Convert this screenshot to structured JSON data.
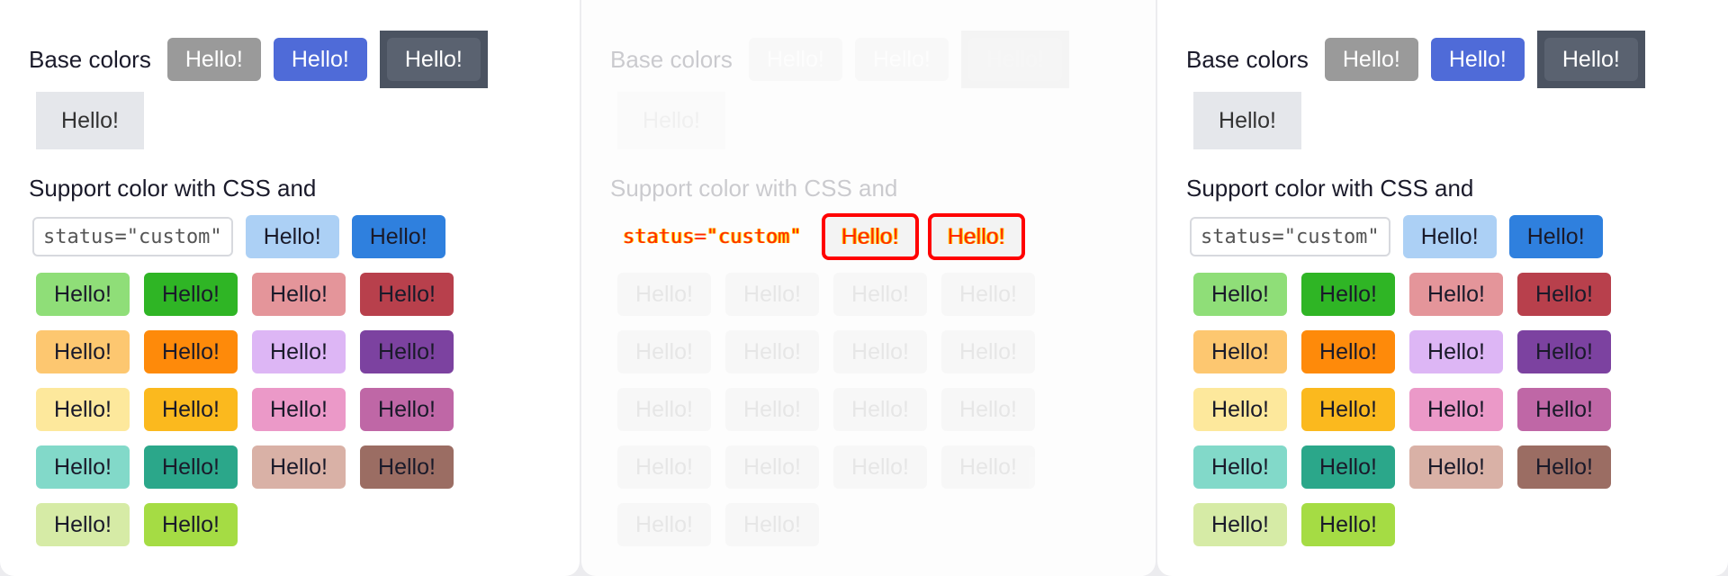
{
  "base_label": "Base colors",
  "support_label": "Support color with CSS and",
  "code_text": "status=\"custom\"",
  "hello": "Hello!",
  "base_buttons": [
    {
      "bg": "#9a9a9a",
      "fg": "#ffffff"
    },
    {
      "bg": "#4f6bd8",
      "fg": "#ffffff"
    },
    {
      "bg": "#5a6270",
      "fg": "#ffffff"
    },
    {
      "bg": "#e5e7eb",
      "fg": "#333333"
    }
  ],
  "support_buttons": [
    {
      "bg": "#acd0f5",
      "fg": "#1a1a2a"
    },
    {
      "bg": "#2f80de",
      "fg": "#1a1a2a"
    }
  ],
  "grid_buttons": [
    {
      "bg": "#8fde78",
      "fg": "#1a1a2a"
    },
    {
      "bg": "#2fb525",
      "fg": "#1a1a2a"
    },
    {
      "bg": "#e4959a",
      "fg": "#1a1a2a"
    },
    {
      "bg": "#b8404c",
      "fg": "#1a1a2a"
    },
    {
      "bg": "#fdc770",
      "fg": "#1a1a2a"
    },
    {
      "bg": "#fe8a0a",
      "fg": "#1a1a2a"
    },
    {
      "bg": "#ddb6f5",
      "fg": "#1a1a2a"
    },
    {
      "bg": "#7c42a0",
      "fg": "#1a1a2a"
    },
    {
      "bg": "#fde89c",
      "fg": "#1a1a2a"
    },
    {
      "bg": "#fbb91e",
      "fg": "#1a1a2a"
    },
    {
      "bg": "#eb99c8",
      "fg": "#1a1a2a"
    },
    {
      "bg": "#bf67a6",
      "fg": "#1a1a2a"
    },
    {
      "bg": "#82d9c9",
      "fg": "#1a1a2a"
    },
    {
      "bg": "#2ba78a",
      "fg": "#1a1a2a"
    },
    {
      "bg": "#d9b1a6",
      "fg": "#1a1a2a"
    },
    {
      "bg": "#9b6d63",
      "fg": "#1a1a2a"
    },
    {
      "bg": "#d6eba6",
      "fg": "#1a1a2a"
    },
    {
      "bg": "#a5dc44",
      "fg": "#1a1a2a"
    }
  ]
}
